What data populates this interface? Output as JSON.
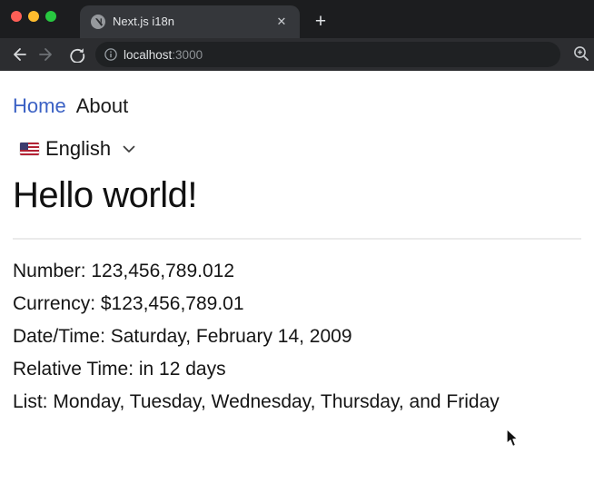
{
  "window": {
    "tab_title": "Next.js i18n",
    "close_tab_glyph": "✕",
    "new_tab_glyph": "+"
  },
  "address_bar": {
    "host": "localhost",
    "port": ":3000"
  },
  "icons": {
    "favicon": "nextjs-globe",
    "back": "left-arrow",
    "forward": "right-arrow",
    "reload": "circular-arrow",
    "page_info": "info-circle",
    "zoom_in": "magnifier-plus",
    "language_flag": "us-flag",
    "chevron": "chevron-down"
  },
  "page": {
    "nav": {
      "home": "Home",
      "about": "About"
    },
    "language_switcher": {
      "label": "English"
    },
    "heading": "Hello world!",
    "facts": [
      "Number: 123,456,789.012",
      "Currency: $123,456,789.01",
      "Date/Time: Saturday, February 14, 2009",
      "Relative Time: in 12 days",
      "List: Monday, Tuesday, Wednesday, Thursday, and Friday"
    ]
  },
  "colors": {
    "frame": "#1c1d1f",
    "tab": "#35373b",
    "toolbar": "#2c2d30",
    "omnibox": "#1f2123",
    "link_blue": "#3b61c4",
    "traffic_red": "#ff5f57",
    "traffic_yellow": "#febc2e",
    "traffic_green": "#28c840"
  }
}
